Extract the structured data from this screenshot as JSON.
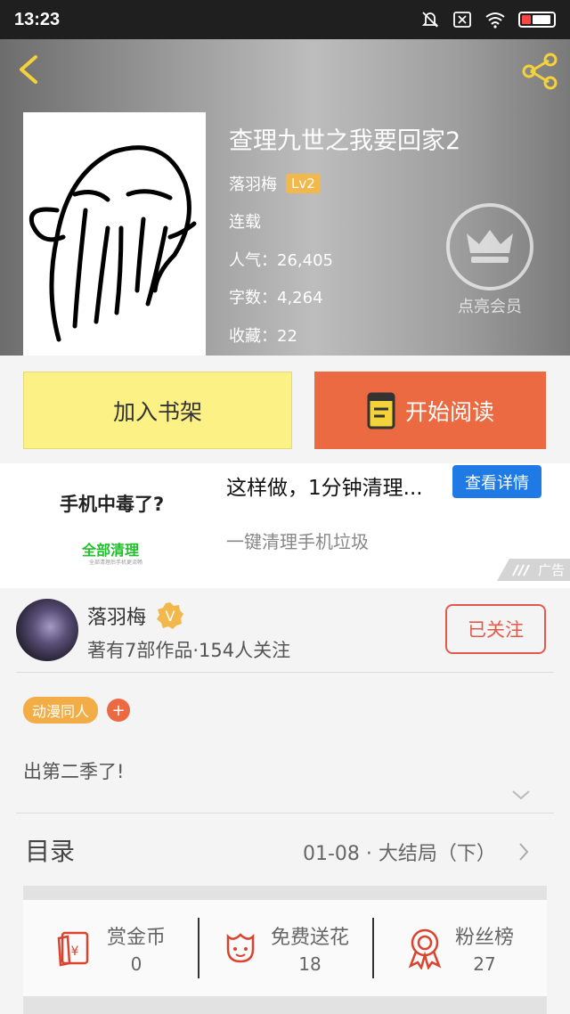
{
  "status_bar": {
    "time": "13:23"
  },
  "book": {
    "title": "查理九世之我要回家2",
    "author": "落羽梅",
    "level": "Lv2",
    "status": "连载",
    "popularity": "人气：26,405",
    "word_count": "字数：4,264",
    "favorites": "收藏：22"
  },
  "vip": {
    "label": "点亮会员"
  },
  "actions": {
    "add_to_shelf": "加入书架",
    "start_reading": "开始阅读"
  },
  "ad": {
    "thumb_title": "手机中毒了?",
    "thumb_subtitle": "全部清理",
    "thumb_tiny": "全部清理后手机更流畅",
    "title": "这样做，1分钟清理...",
    "button": "查看详情",
    "description": "一键清理手机垃圾",
    "tag": "广告"
  },
  "author_card": {
    "name": "落羽梅",
    "badge": "V",
    "stats": "著有7部作品·154人关注",
    "follow_label": "已关注"
  },
  "tags": {
    "items": [
      "动漫同人"
    ],
    "add": "+"
  },
  "synopsis": "出第二季了!",
  "toc": {
    "title": "目录",
    "latest": "01-08 · 大结局（下）"
  },
  "stats": [
    {
      "label": "赏金币",
      "value": "0",
      "icon": "red-envelope-icon"
    },
    {
      "label": "免费送花",
      "value": "18",
      "icon": "flower-icon"
    },
    {
      "label": "粉丝榜",
      "value": "27",
      "icon": "medal-icon"
    }
  ],
  "colors": {
    "accent_orange": "#eb6a41",
    "shelf_yellow": "#fbf184",
    "ad_blue": "#1f7ae6",
    "follow_red": "#e5594a"
  }
}
